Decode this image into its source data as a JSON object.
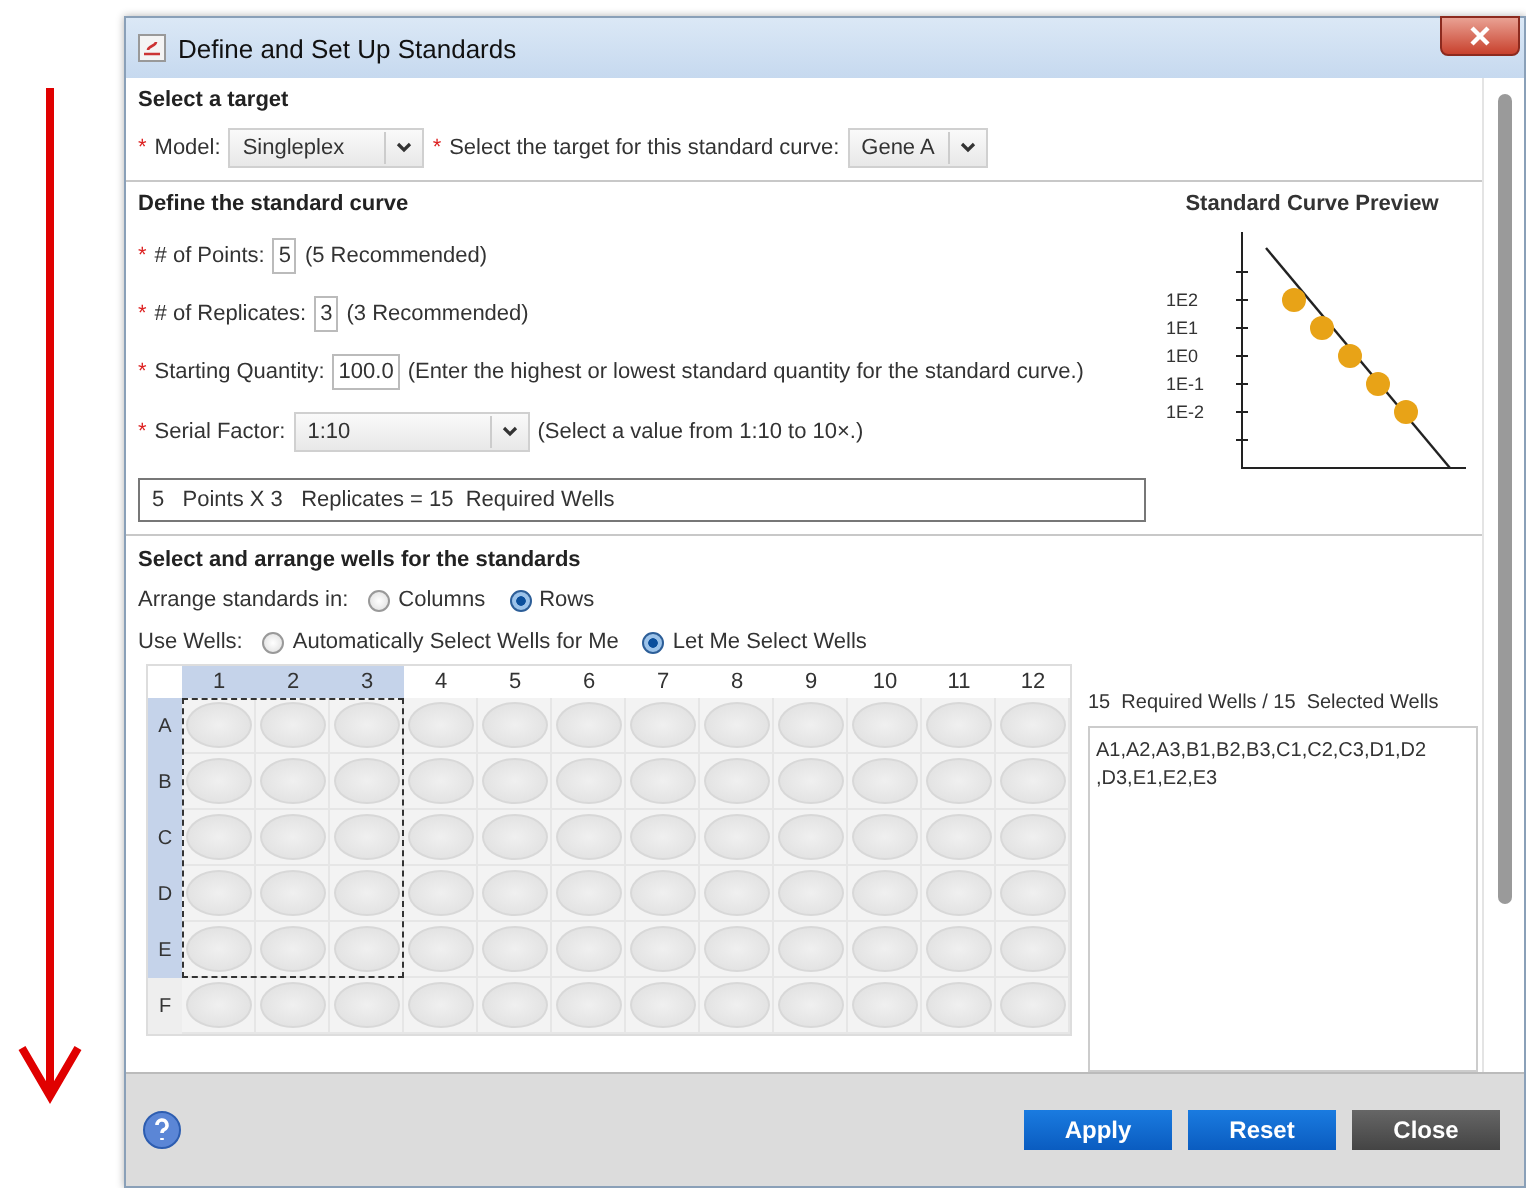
{
  "window": {
    "title": "Define and Set Up Standards"
  },
  "target": {
    "heading": "Select a target",
    "fields": [
      {
        "marker": "*",
        "label": "Model:",
        "value": "Singleplex"
      },
      {
        "marker": "*",
        "label": "Select the target for this standard curve:",
        "value": "Gene A"
      }
    ]
  },
  "standard_curve": {
    "heading": "Define the standard curve",
    "fields": [
      {
        "kind": "input",
        "marker": "*",
        "label": "# of Points:",
        "value": "5",
        "hint": "(5 Recommended)"
      },
      {
        "kind": "input",
        "marker": "*",
        "label": "# of Replicates:",
        "value": "3",
        "hint": "(3 Recommended)"
      },
      {
        "kind": "input",
        "marker": "*",
        "label": "Starting Quantity:",
        "value": "100.0",
        "hint": "(Enter the highest or lowest standard quantity for the standard curve.)"
      },
      {
        "kind": "dropdown",
        "marker": "*",
        "label": "Serial Factor:",
        "value": "1:10",
        "hint": "(Select a value from 1:10 to 10×.)"
      }
    ],
    "summary": "5   Points X 3   Replicates = 15  Required Wells",
    "preview": {
      "title": "Standard Curve Preview",
      "tick_labels": [
        "1E2",
        "1E1",
        "1E0",
        "1E-1",
        "1E-2"
      ]
    }
  },
  "wells": {
    "heading": "Select and arrange wells for the standards",
    "arrange": {
      "label": "Arrange standards in:",
      "options": [
        {
          "label": "Columns",
          "selected": false
        },
        {
          "label": "Rows",
          "selected": true
        }
      ]
    },
    "use_wells": {
      "label": "Use Wells:",
      "options": [
        {
          "label": "Automatically Select Wells for Me",
          "selected": false
        },
        {
          "label": "Let Me Select Wells",
          "selected": true
        }
      ]
    },
    "plate": {
      "columns": [
        {
          "label": "1",
          "selected": true
        },
        {
          "label": "2",
          "selected": true
        },
        {
          "label": "3",
          "selected": true
        },
        {
          "label": "4",
          "selected": false
        },
        {
          "label": "5",
          "selected": false
        },
        {
          "label": "6",
          "selected": false
        },
        {
          "label": "7",
          "selected": false
        },
        {
          "label": "8",
          "selected": false
        },
        {
          "label": "9",
          "selected": false
        },
        {
          "label": "10",
          "selected": false
        },
        {
          "label": "11",
          "selected": false
        },
        {
          "label": "12",
          "selected": false
        }
      ],
      "rows": [
        {
          "label": "A",
          "selected": true
        },
        {
          "label": "B",
          "selected": true
        },
        {
          "label": "C",
          "selected": true
        },
        {
          "label": "D",
          "selected": true
        },
        {
          "label": "E",
          "selected": true
        },
        {
          "label": "F",
          "selected": false
        }
      ]
    },
    "summary": "15  Required Wells / 15  Selected Wells",
    "selected_wells": "A1,A2,A3,B1,B2,B3,C1,C2,C3,D1,D2\n,D3,E1,E2,E3"
  },
  "footer": {
    "buttons": [
      {
        "label": "Apply",
        "kind": "primary"
      },
      {
        "label": "Reset",
        "kind": "primary"
      },
      {
        "label": "Close",
        "kind": "secondary"
      }
    ]
  }
}
